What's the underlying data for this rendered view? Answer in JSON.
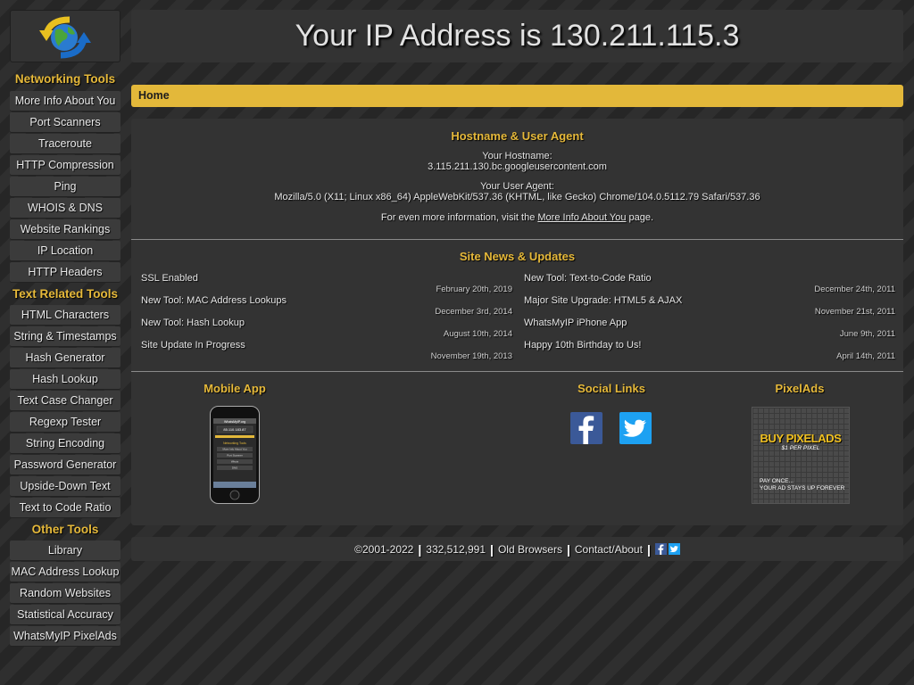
{
  "header": {
    "title": "Your IP Address is 130.211.115.3"
  },
  "breadcrumb": {
    "home": "Home"
  },
  "sidebar": {
    "networking": {
      "title": "Networking Tools",
      "items": [
        "More Info About You",
        "Port Scanners",
        "Traceroute",
        "HTTP Compression",
        "Ping",
        "WHOIS & DNS",
        "Website Rankings",
        "IP Location",
        "HTTP Headers"
      ]
    },
    "text": {
      "title": "Text Related Tools",
      "items": [
        "HTML Characters",
        "String & Timestamps",
        "Hash Generator",
        "Hash Lookup",
        "Text Case Changer",
        "Regexp Tester",
        "String Encoding",
        "Password Generator",
        "Upside-Down Text",
        "Text to Code Ratio"
      ]
    },
    "other": {
      "title": "Other Tools",
      "items": [
        "Library",
        "MAC Address Lookup",
        "Random Websites",
        "Statistical Accuracy",
        "WhatsMyIP PixelAds"
      ]
    }
  },
  "hostinfo": {
    "title": "Hostname & User Agent",
    "hostname_label": "Your Hostname:",
    "hostname_value": "3.115.211.130.bc.googleusercontent.com",
    "ua_label": "Your User Agent:",
    "ua_value": "Mozilla/5.0 (X11; Linux x86_64) AppleWebKit/537.36 (KHTML, like Gecko) Chrome/104.0.5112.79 Safari/537.36",
    "more_prefix": "For even more information, visit the ",
    "more_link": "More Info About You",
    "more_suffix": " page."
  },
  "news": {
    "title": "Site News & Updates",
    "left": [
      {
        "title": "SSL Enabled",
        "date": "February 20th, 2019"
      },
      {
        "title": "New Tool: MAC Address Lookups",
        "date": "December 3rd, 2014"
      },
      {
        "title": "New Tool: Hash Lookup",
        "date": "August 10th, 2014"
      },
      {
        "title": "Site Update In Progress",
        "date": "November 19th, 2013"
      }
    ],
    "right": [
      {
        "title": "New Tool: Text-to-Code Ratio",
        "date": "December 24th, 2011"
      },
      {
        "title": "Major Site Upgrade: HTML5 & AJAX",
        "date": "November 21st, 2011"
      },
      {
        "title": "WhatsMyIP iPhone App",
        "date": "June 9th, 2011"
      },
      {
        "title": "Happy 10th Birthday to Us!",
        "date": "April 14th, 2011"
      }
    ]
  },
  "promo": {
    "mobile_title": "Mobile App",
    "phone_screen": {
      "app_name": "WhatsMyIP.org",
      "ip_display": "85.110.183.87",
      "section": "Networking Tools",
      "items": [
        "More Info About You",
        "Port Scanner",
        "Whois",
        "DNS"
      ]
    },
    "social_title": "Social Links",
    "pixelads_title": "PixelAds",
    "pixelads_line1": "BUY PIXELADS",
    "pixelads_line2": "$1 PER PIXEL",
    "pixelads_line3": "PAY ONCE...",
    "pixelads_line4": "YOUR AD STAYS UP FOREVER"
  },
  "footer": {
    "copyright": "©2001-2022",
    "count": "332,512,991",
    "old_browsers": "Old Browsers",
    "contact": "Contact/About"
  },
  "colors": {
    "accent": "#e6b93a",
    "breadcrumb_bg": "#e3b83a",
    "panel_bg": "#333333",
    "facebook": "#3b5998",
    "twitter": "#1da1f2"
  },
  "icons": {
    "logo": "globe-arrows-icon",
    "facebook": "facebook-icon",
    "twitter": "twitter-icon"
  }
}
